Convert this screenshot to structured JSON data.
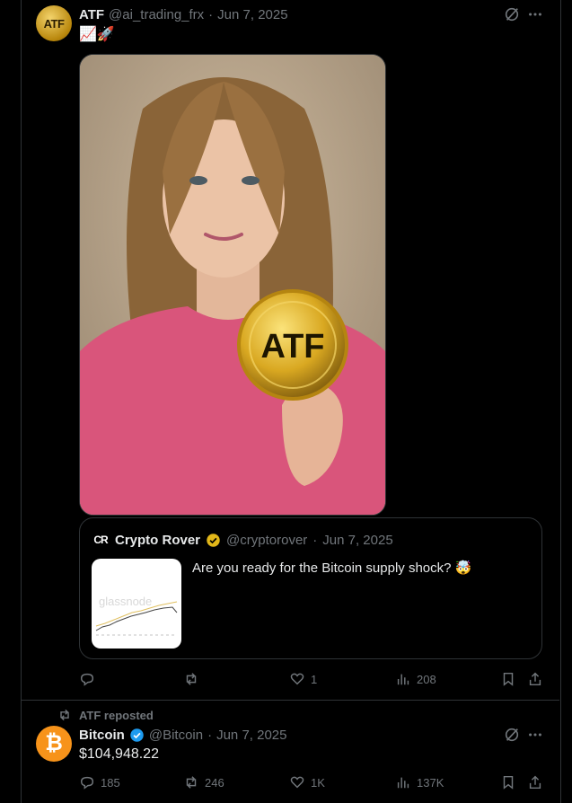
{
  "tweet1": {
    "author_name": "ATF",
    "handle": "@ai_trading_frx",
    "date": "Jun 7, 2025",
    "text": "📈🚀",
    "avatar_text": "ATF",
    "coin_text": "ATF",
    "quote": {
      "author_name": "Crypto Rover",
      "handle": "@cryptorover",
      "date": "Jun 7, 2025",
      "text": "Are you ready for the Bitcoin supply shock? 🤯",
      "logo_text": "CR",
      "thumb_watermark": "glassnode"
    },
    "actions": {
      "replies": "",
      "reposts": "",
      "likes": "1",
      "views": "208"
    }
  },
  "repost_banner": "ATF reposted",
  "tweet2": {
    "author_name": "Bitcoin",
    "handle": "@Bitcoin",
    "date": "Jun 7, 2025",
    "text": "$104,948.22",
    "avatar_text": "₿",
    "actions": {
      "replies": "185",
      "reposts": "246",
      "likes": "1K",
      "views": "137K"
    }
  },
  "colors": {
    "background": "#000000",
    "border": "#2f3336",
    "muted": "#71767b",
    "verified_gold": "#e2b719",
    "verified_blue": "#1d9bf0",
    "bitcoin_orange": "#f7931a"
  }
}
